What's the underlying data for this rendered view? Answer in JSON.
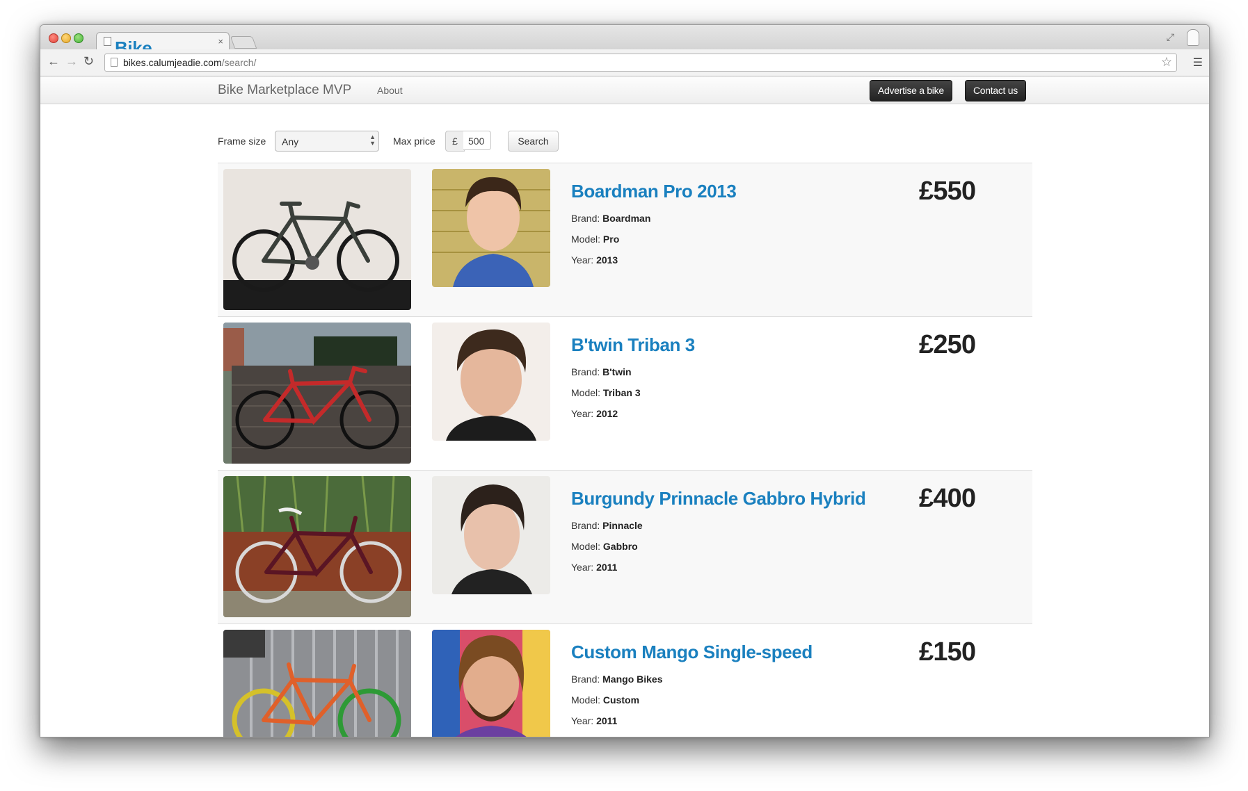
{
  "browser": {
    "tab_title": "Bike Marketplace MVP |",
    "tab_close": "×",
    "url_host": "bikes.calumjeadie.com",
    "url_path": "/search/"
  },
  "navbar": {
    "brand": "Bike Marketplace MVP",
    "about": "About",
    "advertise": "Advertise a bike",
    "contact": "Contact us"
  },
  "filters": {
    "frame_size_label": "Frame size",
    "frame_size_value": "Any",
    "max_price_label": "Max price",
    "currency": "£",
    "max_price_value": "500",
    "search_label": "Search"
  },
  "labels": {
    "brand": "Brand: ",
    "model": "Model: ",
    "year": "Year: "
  },
  "listings": [
    {
      "title": "Boardman Pro 2013",
      "brand": "Boardman",
      "model": "Pro",
      "year": "2013",
      "price": "£550"
    },
    {
      "title": "B'twin Triban 3",
      "brand": "B'twin",
      "model": "Triban 3",
      "year": "2012",
      "price": "£250"
    },
    {
      "title": "Burgundy Prinnacle Gabbro Hybrid",
      "brand": "Pinnacle",
      "model": "Gabbro",
      "year": "2011",
      "price": "£400"
    },
    {
      "title": "Custom Mango Single-speed",
      "brand": "Mango Bikes",
      "model": "Custom",
      "year": "2011",
      "price": "£150"
    }
  ],
  "colors": {
    "link": "#1a80bf",
    "dark_button": "#222222",
    "row_alt": "#f8f8f8"
  }
}
